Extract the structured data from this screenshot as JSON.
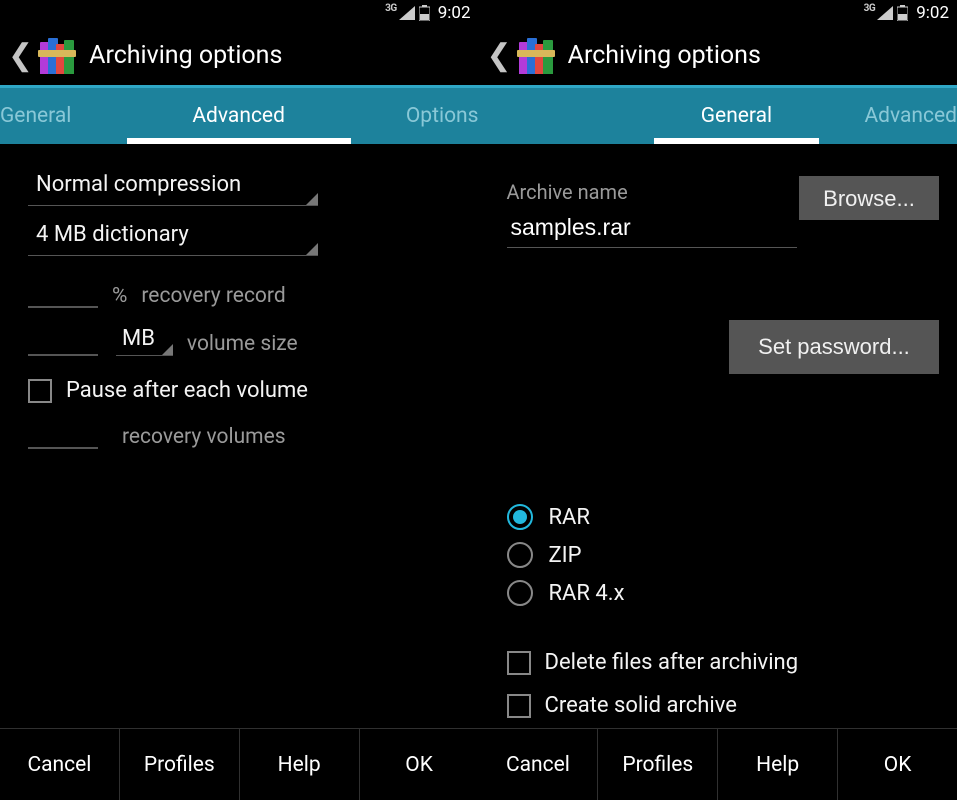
{
  "status": {
    "network": "3G",
    "time": "9:02"
  },
  "app_title": "Archiving options",
  "left": {
    "tabs": {
      "general": "General",
      "advanced": "Advanced",
      "options": "Options"
    },
    "active_tab": "advanced",
    "compression": "Normal compression",
    "dictionary": "4 MB dictionary",
    "percent_label": "%",
    "recovery_record": "recovery record",
    "vol_unit": "MB",
    "volume_size": "volume size",
    "pause_label": "Pause after each volume",
    "recovery_volumes": "recovery volumes"
  },
  "right": {
    "tabs": {
      "general": "General",
      "advanced": "Advanced"
    },
    "active_tab": "general",
    "browse": "Browse...",
    "archive_name_label": "Archive name",
    "archive_name": "samples.rar",
    "set_password": "Set password...",
    "formats": {
      "rar": "RAR",
      "zip": "ZIP",
      "rar4x": "RAR 4.x"
    },
    "selected_format": "rar",
    "delete_after": "Delete files after archiving",
    "solid": "Create solid archive"
  },
  "footer": {
    "cancel": "Cancel",
    "profiles": "Profiles",
    "help": "Help",
    "ok": "OK"
  }
}
